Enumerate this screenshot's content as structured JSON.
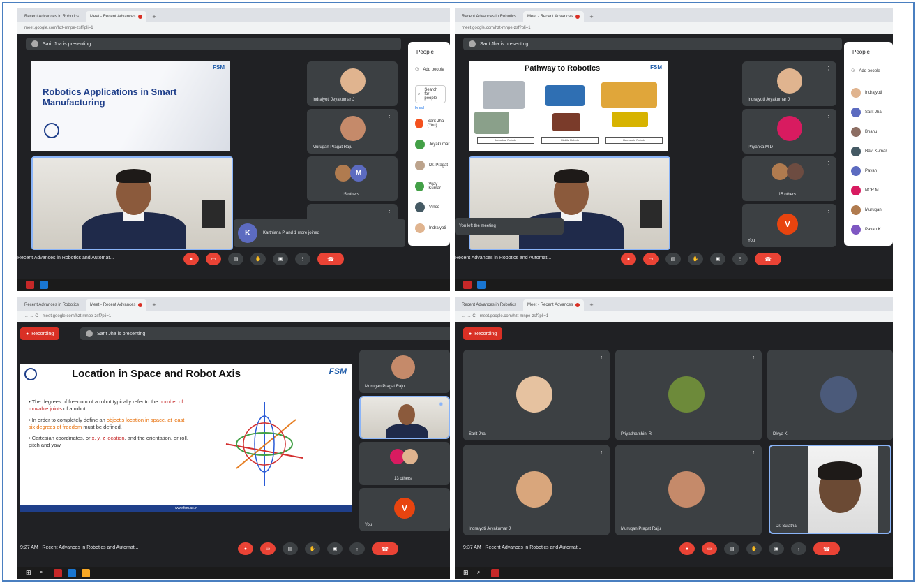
{
  "panels": {
    "top_left": {
      "presenting_text": "Sarit Jha is presenting",
      "slide_title": "Robotics Applications in Smart Manufacturing",
      "slide_brand": "FSM",
      "tiles": [
        "Indrajyoti Jeyakumar J",
        "Murugan Pragat Raju",
        "15 others"
      ],
      "other_avatar_letter": "M",
      "toast_letter": "K",
      "toast_text": "Karthiana P and 1 more joined",
      "meeting_title": "Recent Advances in Robotics and Automat...",
      "people": {
        "title": "People",
        "add": "Add people",
        "search": "Search for people",
        "in_call": "In call",
        "rows": [
          "Sarit Jha (You)",
          "Jeyakumar",
          "Dr. Pragat",
          "Vijay Kumar",
          "Vinod",
          "Indrajyoti"
        ]
      }
    },
    "top_right": {
      "presenting_text": "Sarit Jha is presenting",
      "slide_title": "Pathway to Robotics",
      "slide_brand": "FSM",
      "slide_labels": [
        "Industrial Robots",
        "Mobile Robots",
        "Humanoid Robots"
      ],
      "tiles": [
        "Indrajyoti Jeyakumar J",
        "Priyanka M D",
        "15 others",
        "You"
      ],
      "you_letter": "V",
      "toast_text": "You left the meeting",
      "meeting_title": "Recent Advances in Robotics and Automat...",
      "people": {
        "title": "People",
        "add": "Add people",
        "rows": [
          "Indrajyoti",
          "Sarit Jha",
          "Bhanu",
          "Ravi Kumar",
          "Pavan",
          "NCR M",
          "Murugan",
          "Pavan K"
        ]
      }
    },
    "bottom_left": {
      "recording": "Recording",
      "presenting_text": "Sarit Jha is presenting",
      "slide_title": "Location in Space and Robot Axis",
      "slide_brand": "FSM",
      "bullets": [
        {
          "pre": "The degrees of freedom of a robot typically refer to the ",
          "hl": "number of movable joints",
          "post": " of a robot."
        },
        {
          "pre": "In order to completely define an ",
          "hl": "object's location in space, at least six degrees of freedom",
          "post": " must be defined."
        },
        {
          "pre": "Cartesian coordinates, or ",
          "hl": "x, y, z location",
          "post": ", and the orientation, or roll, pitch and yaw."
        }
      ],
      "footer": "www.fsm.ac.in",
      "tiles": [
        "Murugan Pragat Raju",
        "",
        "13 others",
        "You"
      ],
      "you_letter": "V",
      "time": "9:27 AM",
      "meeting_title": "Recent Advances in Robotics and Automat..."
    },
    "bottom_right": {
      "recording": "Recording",
      "tiles": [
        "Sarit Jha",
        "Priyadharshini R",
        "Divya K",
        "Indrajyoti Jeyakumar J",
        "Murugan Pragat Raju",
        "Dr. Sujatha"
      ],
      "time": "9:37 AM",
      "meeting_title": "Recent Advances in Robotics and Automat..."
    }
  },
  "tab_bar": {
    "tab1": "Recent Advances in Robotics",
    "tab2": "Meet - Recent Advances",
    "url": "meet.google.com/hzt-mnpe-zsf?pli=1"
  },
  "colors": {
    "meet_bg": "#202124",
    "tile": "#3c4043",
    "red": "#ea4335",
    "frame": "#4a7fc0"
  }
}
